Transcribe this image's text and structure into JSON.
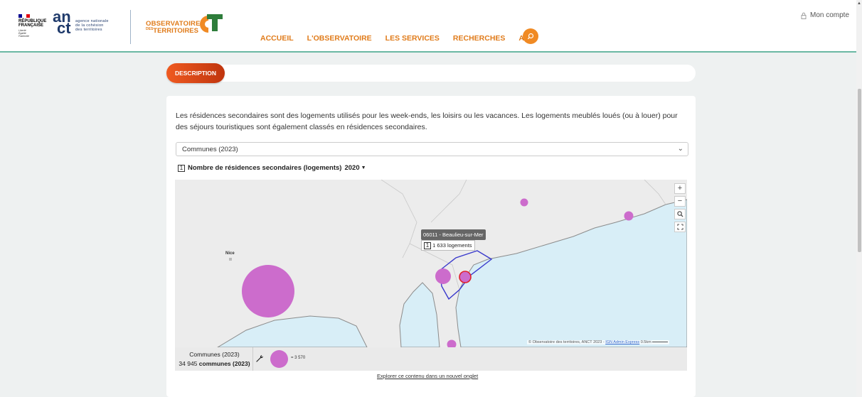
{
  "header": {
    "republique_lines": [
      "RÉPUBLIQUE",
      "FRANÇAISE"
    ],
    "devise": [
      "Liberté",
      "Égalité",
      "Fraternité"
    ],
    "anct_logo": [
      "an",
      "ct"
    ],
    "anct_text": [
      "agence nationale",
      "de la cohésion",
      "des territoires"
    ],
    "obs_logo_line1": "OBSERVATOIRE",
    "obs_logo_des": "DES",
    "obs_logo_line2": "TERRITOIRES",
    "nav": [
      "ACCUEIL",
      "L'OBSERVATOIRE",
      "LES SERVICES",
      "RECHERCHES",
      "AIDE"
    ],
    "account_label": "Mon compte",
    "icons": [
      "search-icon",
      "lock-icon"
    ]
  },
  "tab": {
    "label": "DESCRIPTION"
  },
  "content": {
    "description": "Les résidences secondaires sont des logements utilisés pour les week-ends, les loisirs ou les vacances. Les logements meublés loués (ou à louer) pour des séjours touristiques sont également classés en résidences secondaires.",
    "select_value": "Communes (2023)",
    "indicator_num": "1",
    "indicator_label": "Nombre de résidences secondaires (logements)",
    "indicator_year": "2020",
    "year_arrow": "▼"
  },
  "map": {
    "controls": [
      "+",
      "−",
      "search-icon",
      "fullscreen-icon"
    ],
    "place_label": "Nice",
    "tooltip_title": "06011 - Beaulieu-sur-Mer",
    "tooltip_num": "1",
    "tooltip_value": "1 633 logements",
    "attribution_text": "© Observatoire des territoires, ANCT 2023 - ",
    "attribution_link": "IGN Admin Express",
    "scale": "0.5km",
    "colors": {
      "land": "#ececec",
      "sea": "#d8eef7",
      "bubble": "#cc6ccc",
      "selection": "#3a3acc",
      "highlight": "#e0202a"
    }
  },
  "legend": {
    "level": "Communes (2023)",
    "count": "34 945",
    "count_unit": "communes (2023)",
    "bubble_value": "= 3 570"
  },
  "footer_link": "Explorer ce contenu dans un nouvel onglet"
}
